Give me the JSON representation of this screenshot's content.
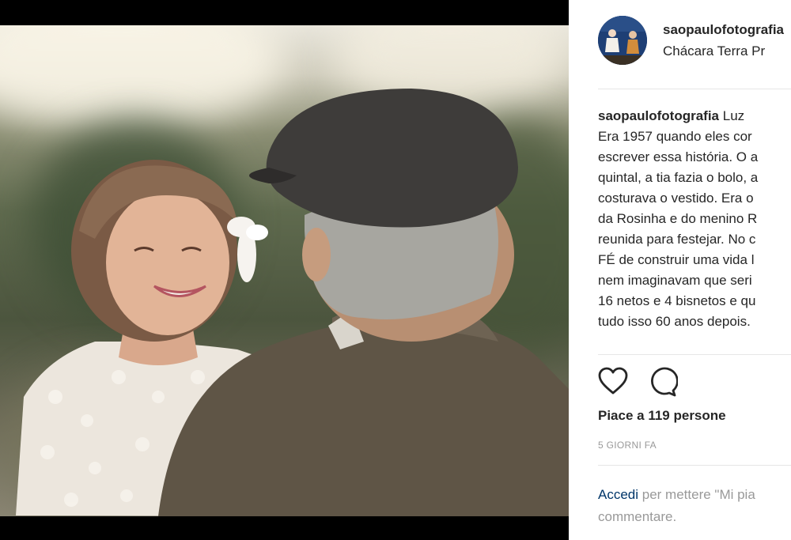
{
  "post": {
    "username": "saopaulofotografia",
    "location": "Chácara Terra Pr",
    "caption_author": "saopaulofotografia",
    "caption_lines": [
      "Luz",
      "Era 1957 quando eles cor",
      "escrever essa história. O a",
      "quintal, a tia fazia o bolo, a",
      "costurava o vestido. Era o",
      "da Rosinha e do menino R",
      "reunida para festejar. No c",
      "FÉ de construir uma vida l",
      "nem imaginavam que seri",
      "16 netos e 4 bisnetos e qu",
      "tudo isso 60 anos depois."
    ],
    "likes": "Piace a 119 persone",
    "time_ago": "5 GIORNI FA",
    "login_link": "Accedi",
    "login_rest_line1": " per mettere \"Mi pia",
    "login_rest_line2": "commentare."
  },
  "icons": {
    "like": "heart-icon",
    "comment": "comment-icon",
    "avatar": "profile-avatar"
  },
  "colors": {
    "link": "#003569",
    "muted": "#999999",
    "text": "#262626",
    "avatar_bg": "#1e3f75"
  }
}
